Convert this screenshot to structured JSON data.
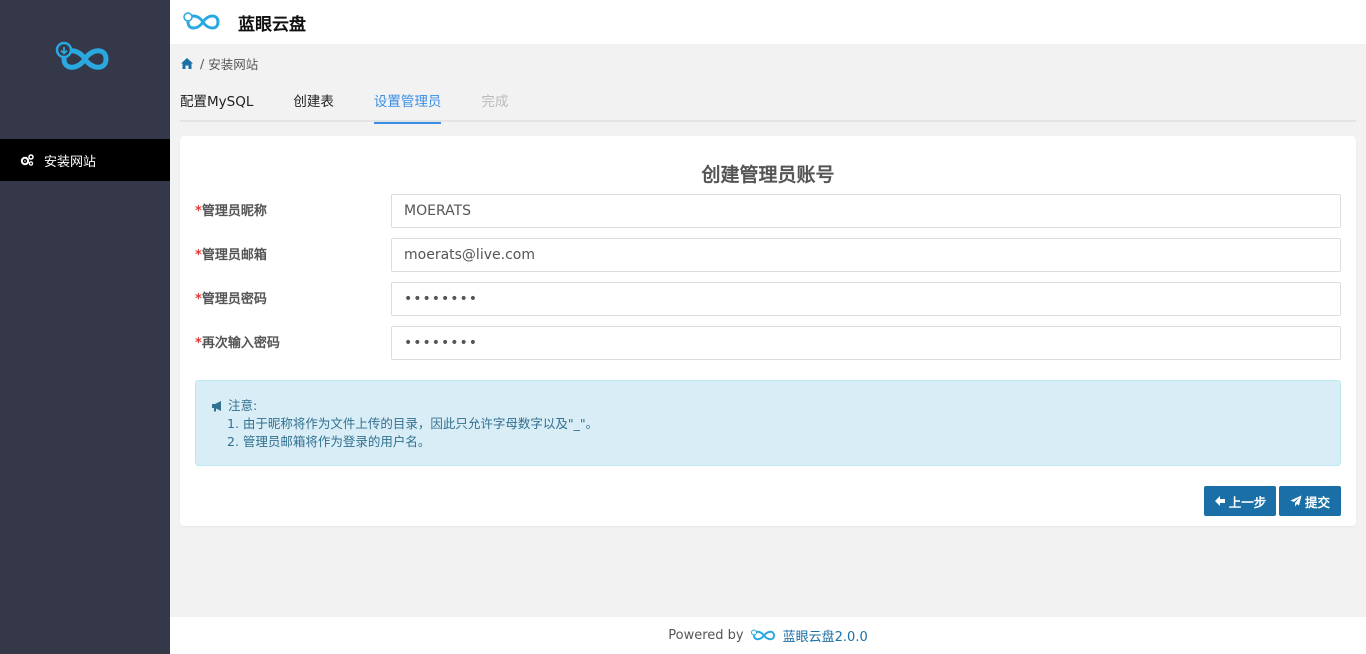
{
  "app": {
    "title": "蓝眼云盘"
  },
  "sidebar": {
    "items": [
      {
        "label": "安装网站",
        "icon": "gears-icon",
        "active": true
      }
    ]
  },
  "breadcrumb": {
    "separator": "/",
    "current": "安装网站"
  },
  "tabs": [
    {
      "label": "配置MySQL",
      "state": "done"
    },
    {
      "label": "创建表",
      "state": "done"
    },
    {
      "label": "设置管理员",
      "state": "active"
    },
    {
      "label": "完成",
      "state": "disabled"
    }
  ],
  "form": {
    "title": "创建管理员账号",
    "required_mark": "*",
    "fields": [
      {
        "label": "管理员昵称",
        "value": "MOERATS",
        "type": "text"
      },
      {
        "label": "管理员邮箱",
        "value": "moerats@live.com",
        "type": "text"
      },
      {
        "label": "管理员密码",
        "value": "••••••••",
        "type": "password"
      },
      {
        "label": "再次输入密码",
        "value": "••••••••",
        "type": "password"
      }
    ]
  },
  "notice": {
    "heading": "注意:",
    "lines": [
      "1. 由于昵称将作为文件上传的目录，因此只允许字母数字以及\"_\"。",
      "2. 管理员邮箱将作为登录的用户名。"
    ]
  },
  "buttons": {
    "prev": "上一步",
    "submit": "提交"
  },
  "footer": {
    "powered_by": "Powered by",
    "brand": "蓝眼云盘2.0.0"
  },
  "colors": {
    "sidebar_bg": "#353849",
    "accent": "#3a8ee6",
    "button": "#1a6fa6",
    "notice_bg": "#d9edf7",
    "required": "#e53935"
  }
}
